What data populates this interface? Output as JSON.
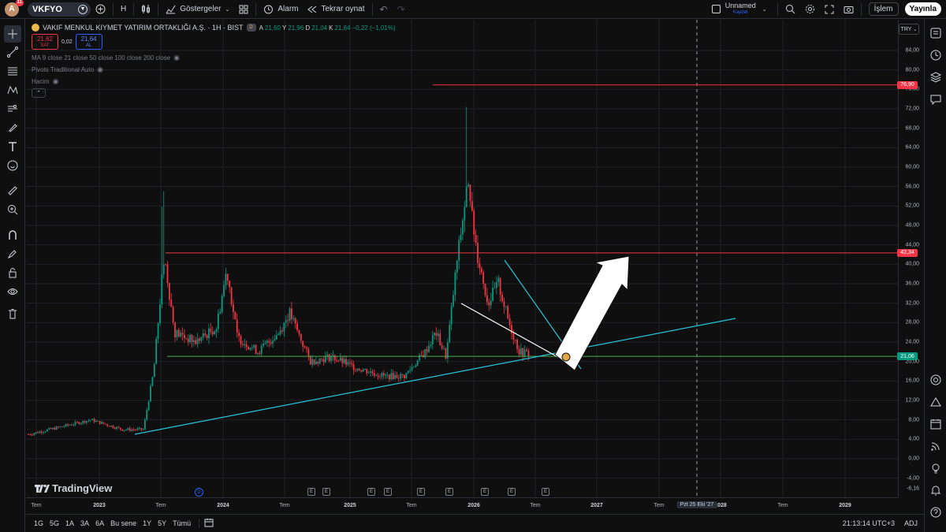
{
  "user": {
    "avatar_letter": "A",
    "notifications": "11"
  },
  "symbol": {
    "ticker": "VKFYO"
  },
  "toolbar": {
    "interval": "H",
    "indicators_label": "Göstergeler",
    "alarm_label": "Alarm",
    "replay_label": "Tekrar oynat",
    "layout_name": "Unnamed",
    "layout_status": "Kaydet",
    "trade_label": "İşlem",
    "publish_label": "Yayınla"
  },
  "legend": {
    "title": "VAKIF MENKUL KIYMET YATIRIM ORTAKLIĞI A.Ş. · 1H · BIST",
    "d_badge": "D",
    "ohlc": {
      "o_label": "A",
      "o": "21,60",
      "h_label": "Y",
      "h": "21,96",
      "l_label": "D",
      "l": "21,04",
      "c_label": "K",
      "c": "21,64",
      "chg": "−0,22 (−1,01%)"
    },
    "sell": {
      "price": "21,62",
      "label": "SAT"
    },
    "spread": "0,02",
    "buy": {
      "price": "21,64",
      "label": "AL"
    },
    "indicators": [
      "MA 9 close 21 close 50 close 100 close 200 close",
      "Pivots Traditional Auto",
      "Hacim"
    ]
  },
  "price_axis": {
    "currency": "TRY",
    "ticks": [
      "84,00",
      "80,00",
      "76,00",
      "72,00",
      "68,00",
      "64,00",
      "60,00",
      "56,00",
      "52,00",
      "48,00",
      "44,00",
      "40,00",
      "36,00",
      "32,00",
      "28,00",
      "24,00",
      "20,00",
      "16,00",
      "12,00",
      "8,00",
      "4,00",
      "0,00",
      "-4,00"
    ],
    "badges": [
      {
        "value": "76,90",
        "color": "#f23645"
      },
      {
        "value": "42,34",
        "color": "#f23645"
      },
      {
        "value": "21,06",
        "color": "#089981"
      }
    ],
    "bottom_value": "-6,16"
  },
  "time_axis": {
    "labels": [
      "Tem",
      "2023",
      "Tem",
      "2024",
      "Tem",
      "2025",
      "Tem",
      "2026",
      "Tem",
      "2027",
      "Tem",
      "2028",
      "Tem",
      "2029"
    ],
    "hover": "Pzt 25 Eki '27"
  },
  "events": [
    "E",
    "E",
    "E",
    "E",
    "E",
    "E",
    "E",
    "E",
    "E"
  ],
  "dividend_marker": "D",
  "bottom_bar": {
    "ranges": [
      "1G",
      "5G",
      "1A",
      "3A",
      "6A",
      "Bu sene",
      "1Y",
      "5Y",
      "Tümü"
    ],
    "clock": "21:13:14 UTC+3",
    "adj": "ADJ"
  },
  "brand": {
    "logo_text": "TradingView"
  },
  "chart_data": {
    "type": "candlestick",
    "ylim": [
      -6.16,
      87
    ],
    "horizontal_levels": [
      76.9,
      42.34,
      21.06
    ],
    "approx_close_path": [
      [
        "2022-06",
        5.0
      ],
      [
        "2022-09",
        6.5
      ],
      [
        "2022-12",
        8.0
      ],
      [
        "2023-03",
        6.0
      ],
      [
        "2023-05",
        6.0
      ],
      [
        "2023-06",
        18.0
      ],
      [
        "2023-07",
        42.0
      ],
      [
        "2023-08",
        26.0
      ],
      [
        "2023-10",
        24.0
      ],
      [
        "2023-12",
        27.0
      ],
      [
        "2024-01",
        39.0
      ],
      [
        "2024-02",
        25.0
      ],
      [
        "2024-04",
        22.0
      ],
      [
        "2024-06",
        26.0
      ],
      [
        "2024-07",
        30.0
      ],
      [
        "2024-09",
        20.0
      ],
      [
        "2024-11",
        21.0
      ],
      [
        "2025-01",
        19.0
      ],
      [
        "2025-04",
        17.0
      ],
      [
        "2025-06",
        17.0
      ],
      [
        "2025-08",
        22.0
      ],
      [
        "2025-09",
        26.0
      ],
      [
        "2025-10",
        21.0
      ],
      [
        "2025-11",
        40.0
      ],
      [
        "2025-12",
        56.0
      ],
      [
        "2026-01",
        42.0
      ],
      [
        "2026-02",
        32.0
      ],
      [
        "2026-03",
        36.0
      ],
      [
        "2026-04",
        28.0
      ],
      [
        "2026-05",
        22.0
      ],
      [
        "2026-06",
        21.6
      ]
    ]
  }
}
